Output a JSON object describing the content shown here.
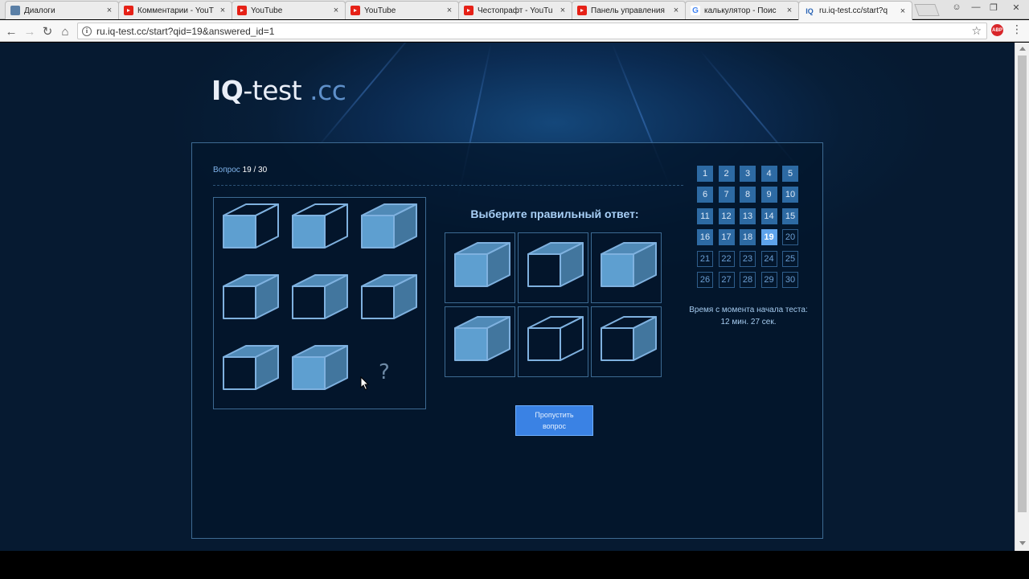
{
  "browser": {
    "tabs": [
      {
        "favicon": "vk-icon",
        "title": "Диалоги"
      },
      {
        "favicon": "youtube-icon",
        "title": "Комментарии - YouT"
      },
      {
        "favicon": "youtube-icon",
        "title": "YouTube"
      },
      {
        "favicon": "youtube-icon",
        "title": "YouTube"
      },
      {
        "favicon": "youtube-icon",
        "title": "Честопрафт - YouTu"
      },
      {
        "favicon": "youtube-icon",
        "title": "Панель управления"
      },
      {
        "favicon": "google-icon",
        "title": "калькулятор - Поис"
      },
      {
        "favicon": "iq-icon",
        "title": "ru.iq-test.cc/start?q"
      }
    ],
    "url": "ru.iq-test.cc/start?qid=19&answered_id=1",
    "abp_label": "ABP"
  },
  "logo": {
    "bold": "IQ",
    "mid": "-test",
    "tld": ".cc"
  },
  "question": {
    "label": "Вопрос",
    "current": "19",
    "separator": "/",
    "total": "30",
    "prompt": "Выберите правильный ответ:",
    "missing_mark": "?",
    "skip_line1": "Пропустить",
    "skip_line2": "вопрос"
  },
  "matrix_cubes": [
    "front-solid",
    "front-solid",
    "all-solid",
    "top-right-solid",
    "top-right-solid",
    "top-right-solid",
    "top-right-solid",
    "all-solid"
  ],
  "answer_cubes": [
    "all-solid",
    "top-right-solid",
    "all-solid",
    "all-solid",
    "outline",
    "right-solid"
  ],
  "nav": {
    "numbers": [
      "1",
      "2",
      "3",
      "4",
      "5",
      "6",
      "7",
      "8",
      "9",
      "10",
      "11",
      "12",
      "13",
      "14",
      "15",
      "16",
      "17",
      "18",
      "19",
      "20",
      "21",
      "22",
      "23",
      "24",
      "25",
      "26",
      "27",
      "28",
      "29",
      "30"
    ],
    "current": 19
  },
  "timer": {
    "label": "Время с момента начала теста:",
    "value": "12 мин. 27 сек."
  },
  "colors": {
    "accent": "#3a82e4",
    "cube_fill": "#5e9fd0",
    "cube_stroke": "#7fb1df",
    "background": "#071e38"
  }
}
